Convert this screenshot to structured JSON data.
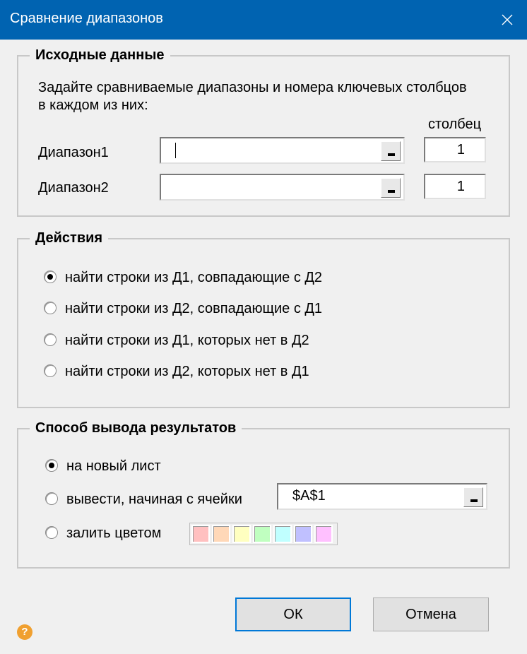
{
  "window": {
    "title": "Сравнение диапазонов"
  },
  "source": {
    "group_title": "Исходные данные",
    "instruction_line1": "Задайте сравниваемые диапазоны и номера ключевых столбцов",
    "instruction_line2": "в каждом из них:",
    "column_header": "столбец",
    "range1": {
      "label": "Диапазон1",
      "value": "",
      "column": "1"
    },
    "range2": {
      "label": "Диапазон2",
      "value": "",
      "column": "1"
    }
  },
  "actions": {
    "group_title": "Действия",
    "options": [
      {
        "label": "найти строки из Д1, совпадающие с Д2",
        "selected": true
      },
      {
        "label": "найти строки из Д2, совпадающие с Д1",
        "selected": false
      },
      {
        "label": "найти строки из Д1, которых нет в Д2",
        "selected": false
      },
      {
        "label": "найти строки из Д2, которых нет в Д1",
        "selected": false
      }
    ]
  },
  "output": {
    "group_title": "Способ вывода результатов",
    "new_sheet_label": "на новый лист",
    "start_cell_label": "вывести, начиная с ячейки",
    "start_cell_value": "$A$1",
    "fill_color_label": "залить цветом",
    "selected_option": "new_sheet",
    "swatches": [
      "#ffc0c0",
      "#ffd8b8",
      "#ffffc0",
      "#c0ffc0",
      "#c0ffff",
      "#c0c0ff",
      "#ffc0ff"
    ]
  },
  "buttons": {
    "ok": "ОК",
    "cancel": "Отмена"
  },
  "help": {
    "glyph": "?"
  }
}
